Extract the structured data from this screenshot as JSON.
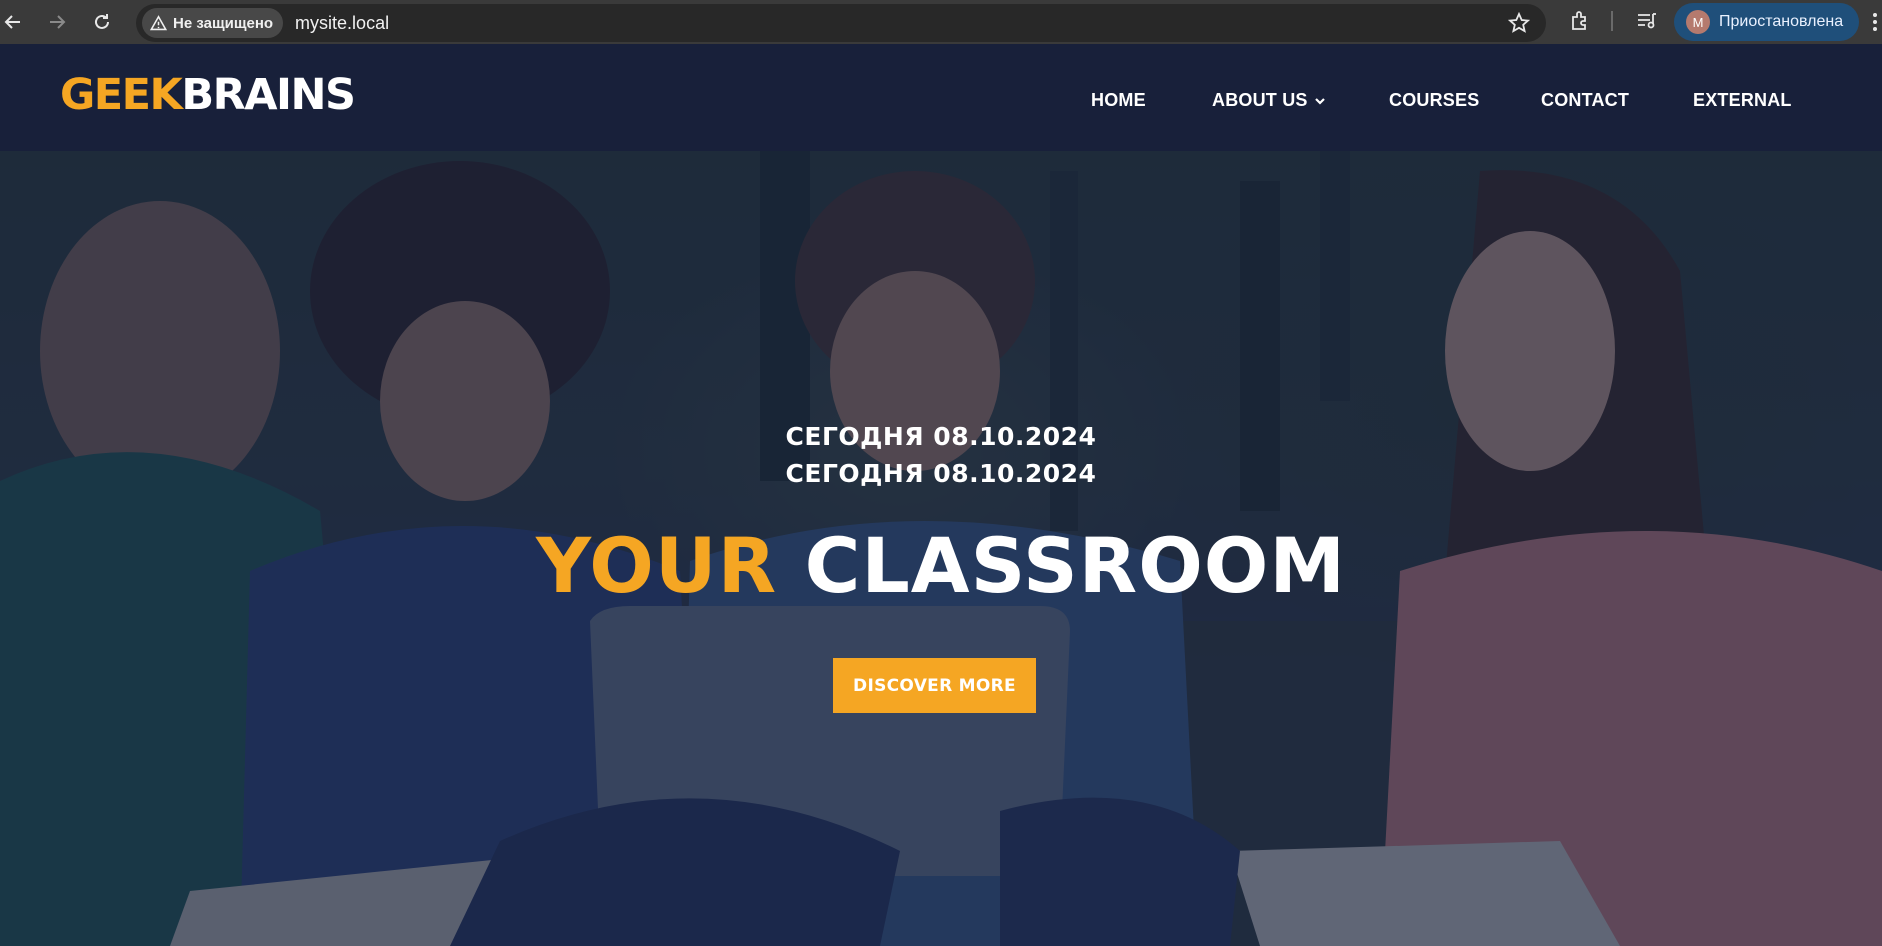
{
  "browser": {
    "security_label": "Не защищено",
    "url": "mysite.local",
    "profile_initial": "M",
    "profile_label": "Приостановлена"
  },
  "site": {
    "logo_part1": "GEEK",
    "logo_part2": "BRAINS",
    "nav": {
      "home": "HOME",
      "about": "ABOUT US",
      "courses": "COURSES",
      "contact": "CONTACT",
      "external": "EXTERNAL"
    }
  },
  "hero": {
    "date_line_1": "СЕГОДНЯ 08.10.2024",
    "date_line_2": "СЕГОДНЯ 08.10.2024",
    "headline_accent": "YOUR",
    "headline_main": "CLASSROOM",
    "cta_label": "DISCOVER MORE"
  },
  "colors": {
    "accent": "#f5a623",
    "header_bg": "#18203a",
    "overlay": "#162242",
    "profile_chip": "#1f4f7a"
  },
  "icons": [
    "back-icon",
    "forward-icon",
    "reload-icon",
    "warning-icon",
    "star-icon",
    "extensions-icon",
    "reading-list-icon",
    "menu-icon",
    "chevron-down-icon"
  ]
}
